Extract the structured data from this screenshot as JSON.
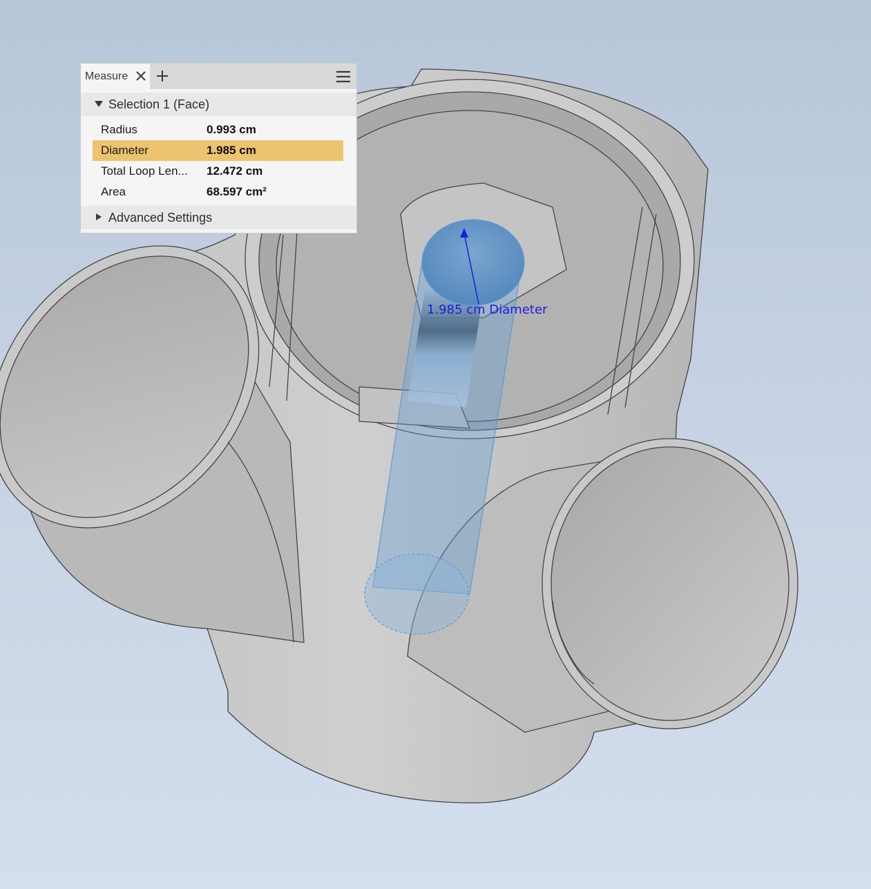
{
  "panel": {
    "tab_label": "Measure",
    "selection_title": "Selection 1 (Face)",
    "rows": [
      {
        "label": "Radius",
        "value": "0.993 cm",
        "highlighted": false
      },
      {
        "label": "Diameter",
        "value": "1.985 cm",
        "highlighted": true
      },
      {
        "label": "Total Loop Len...",
        "value": "12.472 cm",
        "highlighted": false
      },
      {
        "label": "Area",
        "value": "68.597 cm²",
        "highlighted": false
      }
    ],
    "advanced_label": "Advanced Settings"
  },
  "viewport": {
    "dimension_label": "1.985 cm Diameter",
    "highlight_color": "#5b9bd5",
    "dimension_color": "#1d1ddc",
    "highlight_row_color": "#ecc46f"
  }
}
